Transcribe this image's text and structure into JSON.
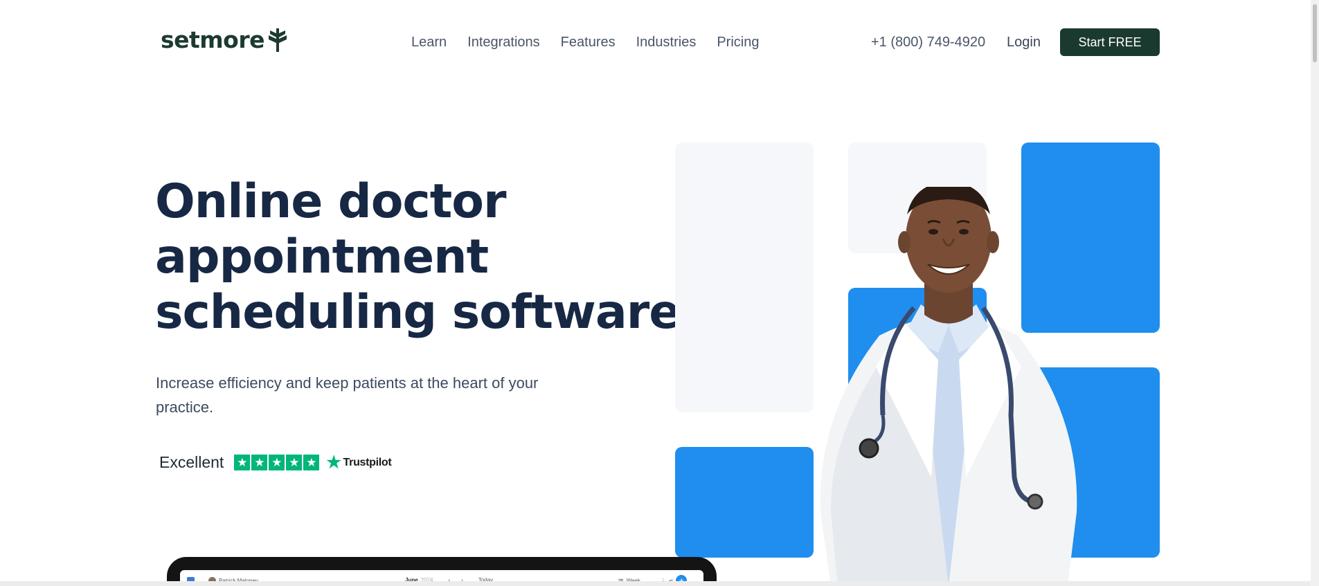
{
  "header": {
    "logo_text": "setmore",
    "nav": [
      "Learn",
      "Integrations",
      "Features",
      "Industries",
      "Pricing"
    ],
    "phone": "+1 (800) 749-4920",
    "login": "Login",
    "cta": "Start FREE"
  },
  "hero": {
    "title_lines": [
      "Online doctor",
      "appointment",
      "scheduling software"
    ],
    "subtitle": "Increase efficiency and keep patients at the heart of your practice.",
    "rating_label": "Excellent",
    "rating_stars": 5,
    "trustpilot": "Trustpilot"
  },
  "preview": {
    "user": "Patrick Maloney",
    "month": "June",
    "year": "2024",
    "today": "Today",
    "view": "Week"
  },
  "colors": {
    "brand_dark": "#1b3a2f",
    "accent_blue": "#1f8eef",
    "trustpilot_green": "#00b67a",
    "heading": "#172845"
  }
}
